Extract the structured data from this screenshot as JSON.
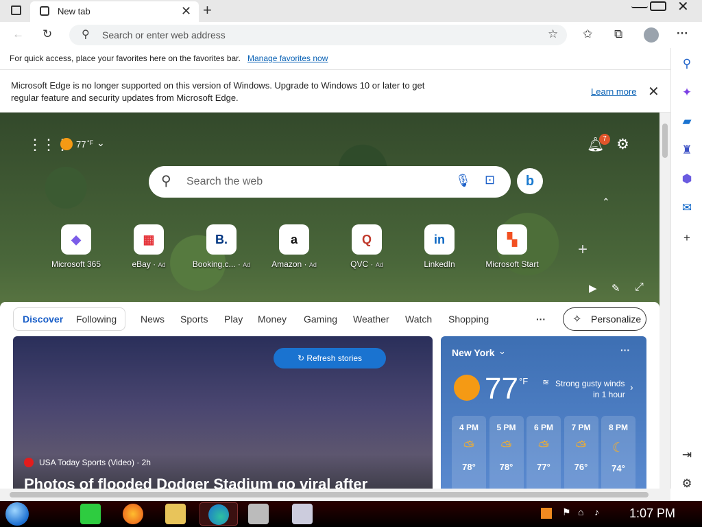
{
  "browser": {
    "tab_title": "New tab",
    "address_placeholder": "Search or enter web address"
  },
  "favorites_bar": {
    "text": "For quick access, place your favorites here on the favorites bar.",
    "link": "Manage favorites now"
  },
  "infobar": {
    "message": "Microsoft Edge is no longer supported on this version of Windows. Upgrade to Windows 10 or later to get regular feature and security updates from Microsoft Edge.",
    "learn_more": "Learn more"
  },
  "newtab": {
    "weather_temp": "77",
    "weather_unit": "°F",
    "notification_count": "7",
    "search_placeholder": "Search the web",
    "quick_links": [
      {
        "label": "Microsoft 365",
        "ad": "",
        "glyph": "◆",
        "color": "#7b5ce8"
      },
      {
        "label": "eBay",
        "ad": "Ad",
        "glyph": "▦",
        "color": "#e53238"
      },
      {
        "label": "Booking.c...",
        "ad": "Ad",
        "glyph": "B.",
        "color": "#003580"
      },
      {
        "label": "Amazon",
        "ad": "Ad",
        "glyph": "a",
        "color": "#111111"
      },
      {
        "label": "QVC",
        "ad": "Ad",
        "glyph": "Q",
        "color": "#c0392b"
      },
      {
        "label": "LinkedIn",
        "ad": "",
        "glyph": "in",
        "color": "#0a66c2"
      },
      {
        "label": "Microsoft Start",
        "ad": "",
        "glyph": "▚",
        "color": "#f25022"
      }
    ]
  },
  "feed": {
    "segment": [
      "Discover",
      "Following"
    ],
    "tabs": [
      "News",
      "Sports",
      "Play",
      "Money",
      "Gaming",
      "Weather",
      "Watch",
      "Shopping"
    ],
    "more": "···",
    "personalize": "Personalize",
    "refresh": "Refresh stories",
    "story_source": "USA Today Sports (Video) · 2h",
    "story_headline": "Photos of flooded Dodger Stadium go viral after"
  },
  "weather_card": {
    "city": "New York",
    "temp": "77",
    "unit": "°F",
    "condition": "Strong gusty winds",
    "condition_time": "in 1 hour",
    "hourly": [
      {
        "time": "4 PM",
        "temp": "78°",
        "icon": "partly-cloudy-icon"
      },
      {
        "time": "5 PM",
        "temp": "78°",
        "icon": "partly-cloudy-icon"
      },
      {
        "time": "6 PM",
        "temp": "77°",
        "icon": "partly-cloudy-icon"
      },
      {
        "time": "7 PM",
        "temp": "76°",
        "icon": "partly-cloudy-icon"
      },
      {
        "time": "8 PM",
        "temp": "74°",
        "icon": "moon-icon"
      }
    ]
  },
  "taskbar": {
    "clock": "1:07 PM"
  }
}
